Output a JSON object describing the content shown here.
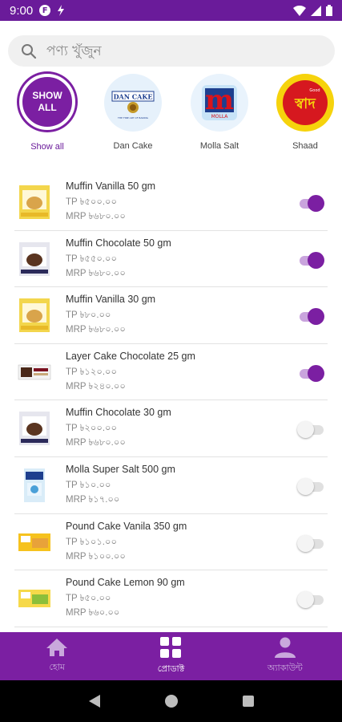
{
  "status_bar": {
    "time": "9:00",
    "badge": "F"
  },
  "search": {
    "placeholder": "পণ্য খুঁজুন"
  },
  "brands": [
    {
      "label": "Show all",
      "circle_text": "SHOW\nALL",
      "active": true
    },
    {
      "label": "Dan Cake",
      "logo_text": "DAN CAKE",
      "logo_sub": "THE FINE ART OF BAKING"
    },
    {
      "label": "Molla Salt",
      "logo_text": "m",
      "logo_sub": "MOLLA"
    },
    {
      "label": "Shaad",
      "logo_text": "স্বাদ",
      "logo_sub": "Good"
    }
  ],
  "products": [
    {
      "name": "Muffin Vanilla 50 gm",
      "tp": "TP ৳৫০০.০০",
      "mrp": "MRP ৳৬৮০.০০",
      "enabled": true,
      "thumb": "muffin-vanilla"
    },
    {
      "name": "Muffin Chocolate 50 gm",
      "tp": "TP ৳৫৫০.০০",
      "mrp": "MRP ৳৬৮০.০০",
      "enabled": true,
      "thumb": "muffin-chocolate"
    },
    {
      "name": "Muffin Vanilla 30 gm",
      "tp": "TP ৳৮০.০০",
      "mrp": "MRP ৳৬৮০.০০",
      "enabled": true,
      "thumb": "muffin-vanilla"
    },
    {
      "name": "Layer Cake Chocolate 25 gm",
      "tp": "TP ৳১২০.০০",
      "mrp": "MRP ৳২৪০.০০",
      "enabled": true,
      "thumb": "layer-cake"
    },
    {
      "name": "Muffin Chocolate 30 gm",
      "tp": "TP ৳২০০.০০",
      "mrp": "MRP ৳৬৮০.০০",
      "enabled": false,
      "thumb": "muffin-chocolate"
    },
    {
      "name": "Molla Super Salt 500 gm",
      "tp": "TP ৳১০.০০",
      "mrp": "MRP ৳১৭.০০",
      "enabled": false,
      "thumb": "salt-pack"
    },
    {
      "name": "Pound Cake Vanila 350 gm",
      "tp": "TP ৳১০১.০০",
      "mrp": "MRP ৳১০০.০০",
      "enabled": false,
      "thumb": "pound-cake"
    },
    {
      "name": "Pound Cake Lemon 90 gm",
      "tp": "TP ৳৫০.০০",
      "mrp": "MRP ৳৬০.০০",
      "enabled": false,
      "thumb": "pound-cake"
    }
  ],
  "bottom_nav": [
    {
      "label": "হোম",
      "icon": "home-icon",
      "active": false
    },
    {
      "label": "প্রোডাক্ট",
      "icon": "grid-icon",
      "active": true
    },
    {
      "label": "অ্যাকাউন্ট",
      "icon": "person-icon",
      "active": false
    }
  ],
  "colors": {
    "primary": "#7b1fa2",
    "status_bar": "#6a1b9a",
    "toggle_on": "#7b1fa2",
    "toggle_track_on": "#c9a4dd"
  }
}
